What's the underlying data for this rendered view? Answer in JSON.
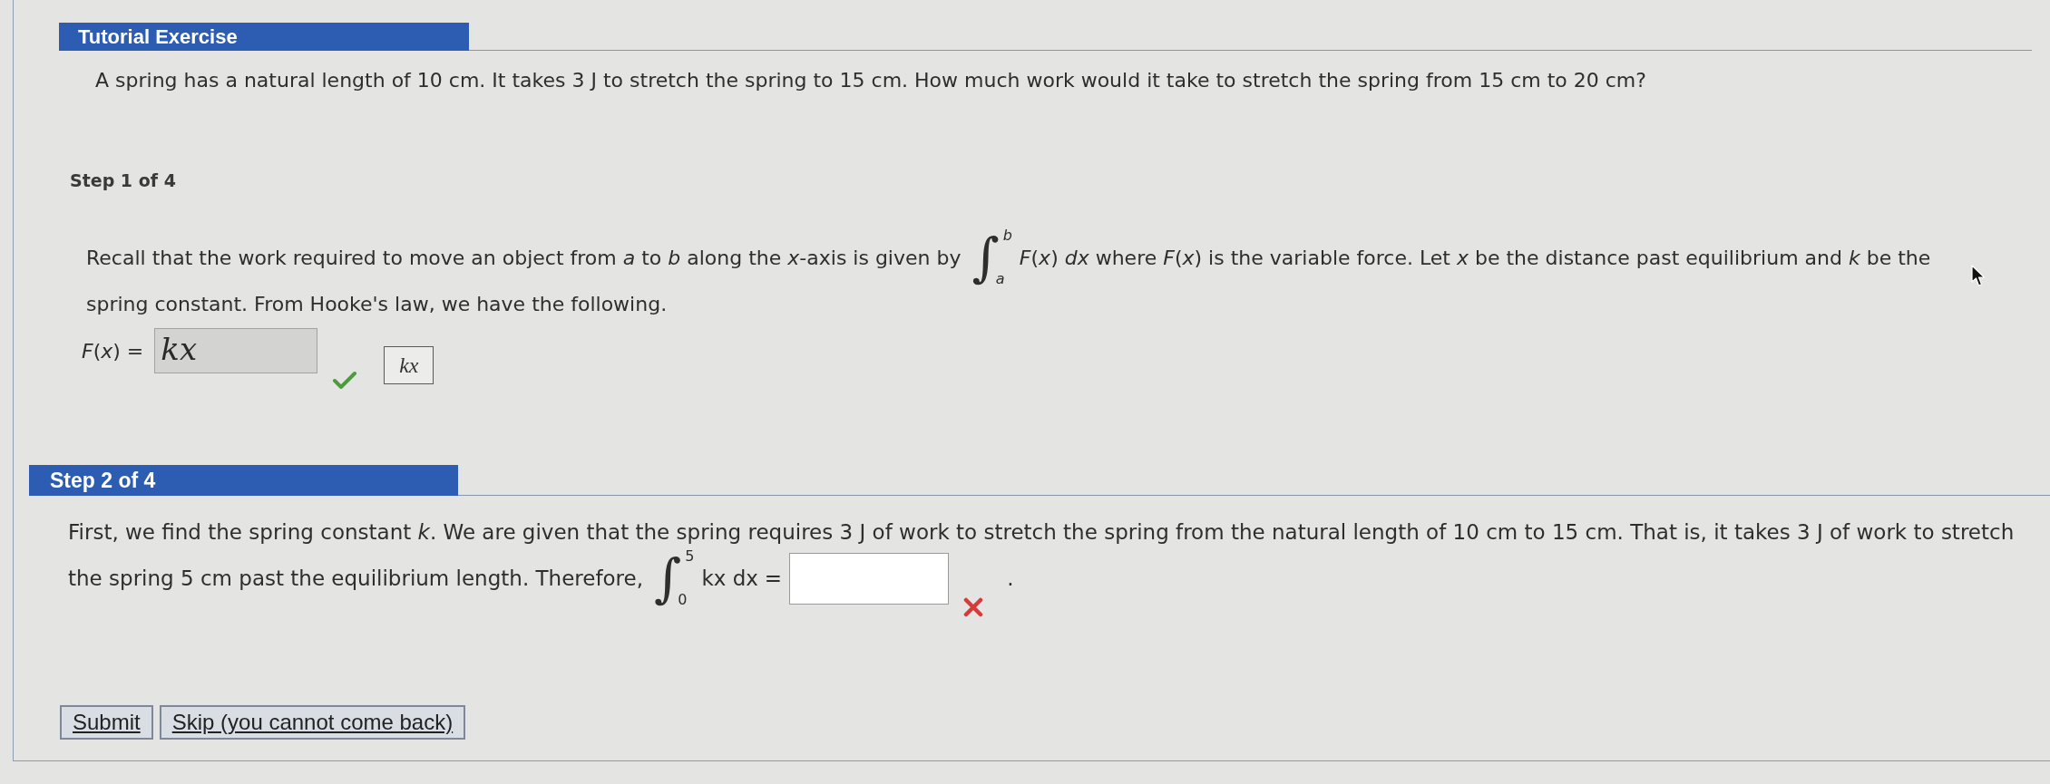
{
  "exercise": {
    "title": "Tutorial Exercise",
    "question": "A spring has a natural length of 10 cm. It takes 3 J to stretch the spring to 15 cm. How much work would it take to stretch the spring from 15 cm to 20 cm?"
  },
  "steps": [
    {
      "label": "Step 1 of 4",
      "current": false,
      "lines": [
        [
          {
            "kind": "text",
            "text": "Recall that the work required to move an object from *a* to *b* along the *x*-axis is given by"
          },
          {
            "kind": "integral",
            "sign": "∫",
            "lower": "*a*",
            "upper": "*b*",
            "integrand": "*F*(*x*) *dx*"
          },
          {
            "kind": "text",
            "text": "where *F*(*x*) is the variable force. Let *x* be the distance past equilibrium and *k* be the"
          }
        ],
        [
          {
            "kind": "text",
            "text": "spring constant. From Hooke's law, we have the following."
          }
        ]
      ],
      "answer": {
        "kind": "row",
        "expression": [
          {
            "kind": "text",
            "text": "*F*(*x*) ="
          }
        ],
        "value": "kx",
        "correct": true,
        "preview": "kx"
      }
    },
    {
      "label": "Step 2 of 4",
      "current": true,
      "lines": [
        [
          {
            "kind": "text",
            "text": "First, we find the spring constant *k*. We are given that the spring requires 3 J of work to stretch the spring from the natural length of 10 cm to 15 cm. That is, it takes 3 J of work to stretch"
          }
        ],
        [
          {
            "kind": "text",
            "text": "the spring 5 cm past the equilibrium length. Therefore,"
          }
        ]
      ],
      "answer": {
        "kind": "inline",
        "expression": [
          {
            "kind": "integral",
            "sign": "∫",
            "lower": "0",
            "upper": "5",
            "integrand": "kx dx"
          },
          {
            "kind": "text",
            "text": "="
          }
        ],
        "correct": false,
        "suffix": "."
      }
    }
  ],
  "buttons": [
    {
      "label": "Submit"
    },
    {
      "label": "Skip (you cannot come back)"
    }
  ]
}
